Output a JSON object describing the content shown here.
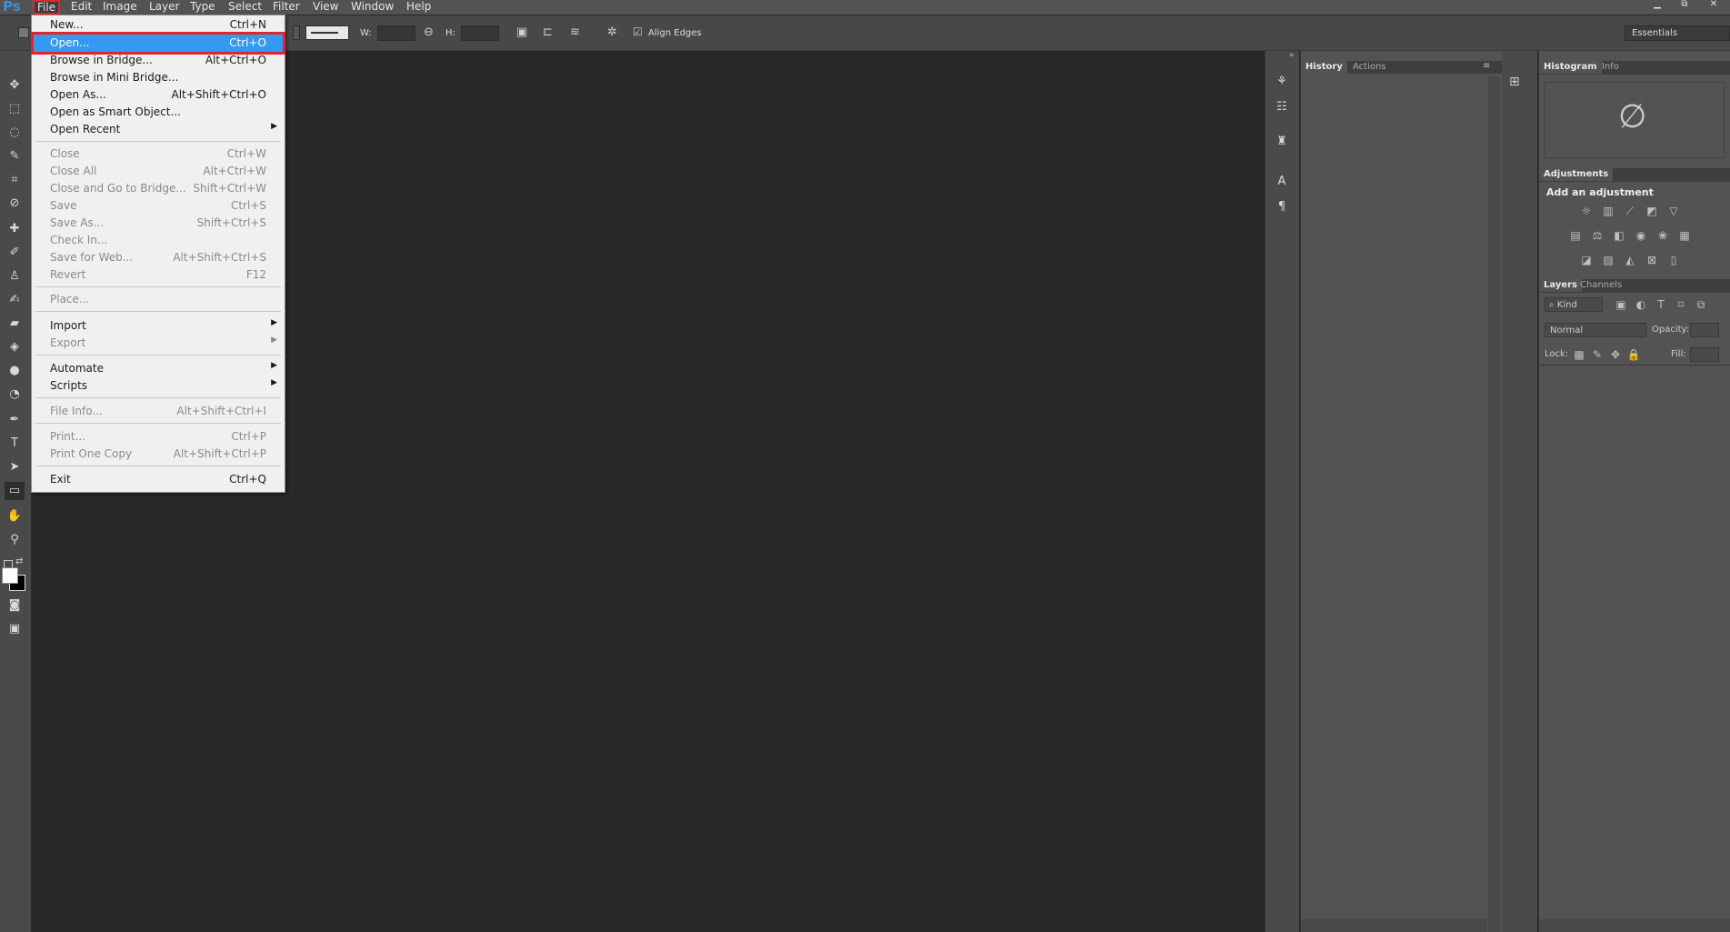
{
  "app": {
    "logo": "Ps"
  },
  "menubar": [
    "File",
    "Edit",
    "Image",
    "Layer",
    "Type",
    "Select",
    "Filter",
    "View",
    "Window",
    "Help"
  ],
  "window_controls": {
    "minimize": "▁",
    "restore": "⧉",
    "close": "✕"
  },
  "options": {
    "w_label": "W:",
    "h_label": "H:",
    "align_edges": "Align Edges",
    "workspace": "Essentials"
  },
  "file_menu": {
    "items": [
      {
        "label": "New...",
        "shortcut": "Ctrl+N",
        "disabled": false
      },
      {
        "label": "Open...",
        "shortcut": "Ctrl+O",
        "disabled": false,
        "highlighted": true
      },
      {
        "label": "Browse in Bridge...",
        "shortcut": "Alt+Ctrl+O",
        "disabled": false
      },
      {
        "label": "Browse in Mini Bridge...",
        "shortcut": "",
        "disabled": false
      },
      {
        "label": "Open As...",
        "shortcut": "Alt+Shift+Ctrl+O",
        "disabled": false
      },
      {
        "label": "Open as Smart Object...",
        "shortcut": "",
        "disabled": false
      },
      {
        "label": "Open Recent",
        "shortcut": "",
        "disabled": false,
        "submenu": true
      },
      {
        "label": "Close",
        "shortcut": "Ctrl+W",
        "disabled": true
      },
      {
        "label": "Close All",
        "shortcut": "Alt+Ctrl+W",
        "disabled": true
      },
      {
        "label": "Close and Go to Bridge...",
        "shortcut": "Shift+Ctrl+W",
        "disabled": true
      },
      {
        "label": "Save",
        "shortcut": "Ctrl+S",
        "disabled": true
      },
      {
        "label": "Save As...",
        "shortcut": "Shift+Ctrl+S",
        "disabled": true
      },
      {
        "label": "Check In...",
        "shortcut": "",
        "disabled": true
      },
      {
        "label": "Save for Web...",
        "shortcut": "Alt+Shift+Ctrl+S",
        "disabled": true
      },
      {
        "label": "Revert",
        "shortcut": "F12",
        "disabled": true
      },
      {
        "label": "Place...",
        "shortcut": "",
        "disabled": true
      },
      {
        "label": "Import",
        "shortcut": "",
        "disabled": false,
        "submenu": true
      },
      {
        "label": "Export",
        "shortcut": "",
        "disabled": true,
        "submenu": true
      },
      {
        "label": "Automate",
        "shortcut": "",
        "disabled": false,
        "submenu": true
      },
      {
        "label": "Scripts",
        "shortcut": "",
        "disabled": false,
        "submenu": true
      },
      {
        "label": "File Info...",
        "shortcut": "Alt+Shift+Ctrl+I",
        "disabled": true
      },
      {
        "label": "Print...",
        "shortcut": "Ctrl+P",
        "disabled": true
      },
      {
        "label": "Print One Copy",
        "shortcut": "Alt+Shift+Ctrl+P",
        "disabled": true
      },
      {
        "label": "Exit",
        "shortcut": "Ctrl+Q",
        "disabled": false
      }
    ],
    "submenu_arrow": "▶"
  },
  "history_panel": {
    "tabs": [
      "History",
      "Actions"
    ]
  },
  "histogram_panel": {
    "tabs": [
      "Histogram",
      "Info"
    ],
    "empty_icon": "∅"
  },
  "adjustments_panel": {
    "title": "Adjustments",
    "subtitle": "Add an adjustment"
  },
  "layers_panel": {
    "tabs": [
      "Layers",
      "Channels"
    ],
    "kind": "⌕ Kind",
    "blend_mode": "Normal",
    "opacity_label": "Opacity:",
    "lock_label": "Lock:",
    "fill_label": "Fill:"
  }
}
